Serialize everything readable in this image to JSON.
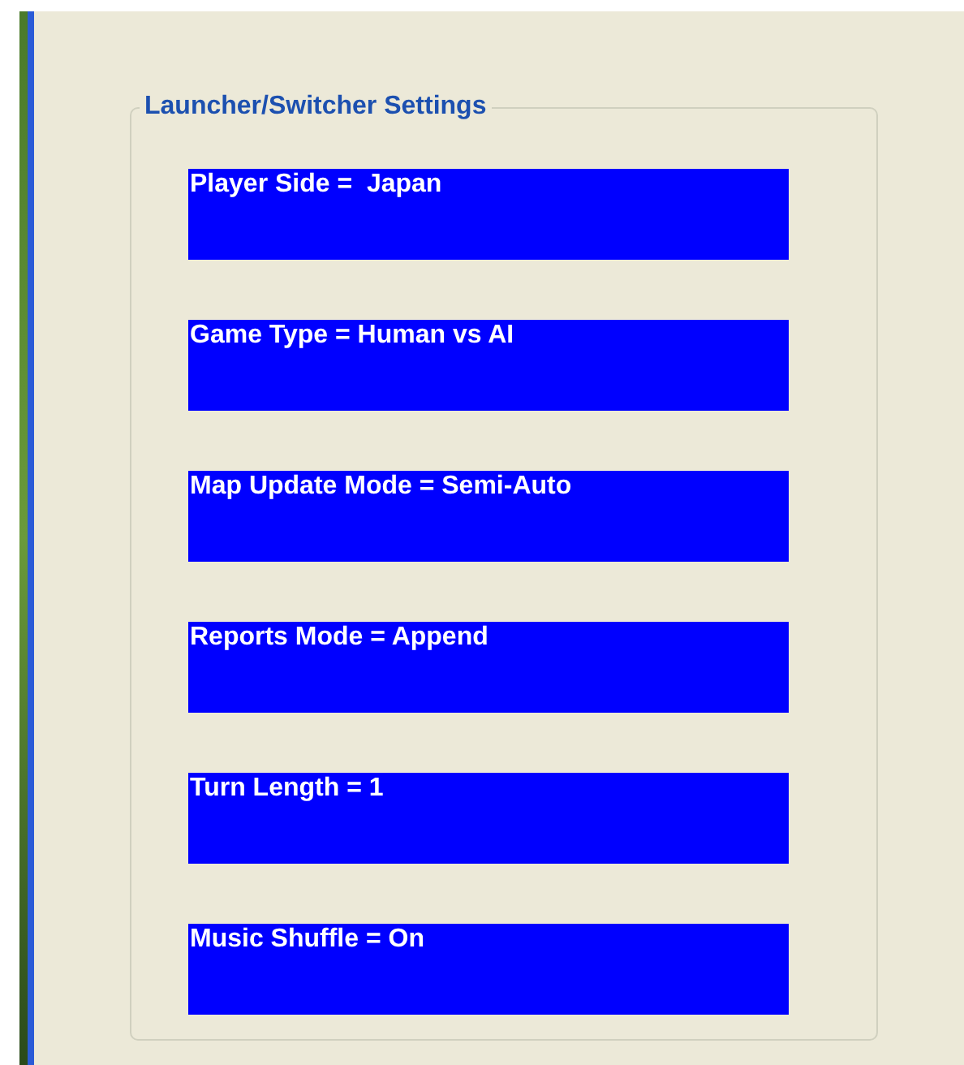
{
  "group": {
    "title": "Launcher/Switcher Settings"
  },
  "buttons": [
    {
      "label": "Player Side =  Japan"
    },
    {
      "label": "Game Type = Human vs AI"
    },
    {
      "label": "Map Update Mode = Semi-Auto"
    },
    {
      "label": "Reports Mode = Append"
    },
    {
      "label": "Turn Length = 1"
    },
    {
      "label": "Music Shuffle = On"
    }
  ]
}
